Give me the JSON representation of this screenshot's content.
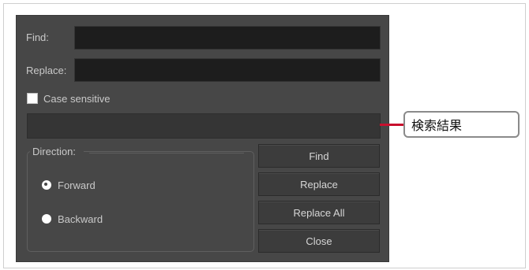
{
  "dialog": {
    "find_label": "Find:",
    "replace_label": "Replace:",
    "find_value": "",
    "replace_value": "",
    "case_sensitive_label": "Case sensitive",
    "case_sensitive_checked": false,
    "result_text": "",
    "direction": {
      "title": "Direction:",
      "options": [
        {
          "label": "Forward",
          "selected": true
        },
        {
          "label": "Backward",
          "selected": false
        }
      ]
    },
    "buttons": {
      "find": "Find",
      "replace": "Replace",
      "replace_all": "Replace All",
      "close": "Close"
    }
  },
  "callout": {
    "label": "検索結果",
    "line_color": "#c8102e"
  }
}
